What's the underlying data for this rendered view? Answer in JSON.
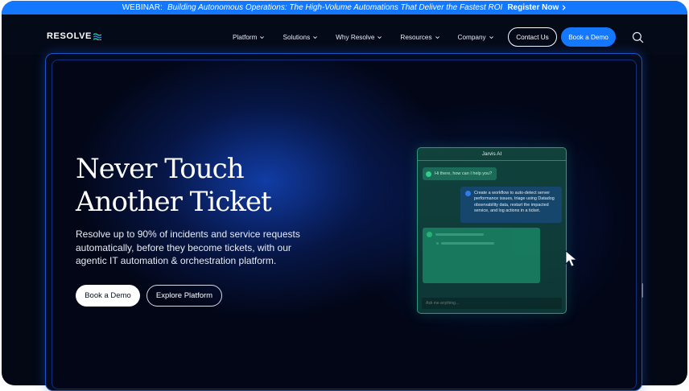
{
  "banner": {
    "lead": "WEBINAR:",
    "title": "Building Autonomous Operations: The High-Volume Automations That Deliver the Fastest ROI",
    "cta": "Register Now",
    "cta_icon": "chevron-right-icon"
  },
  "nav": {
    "logo_text": "RESOLVE",
    "menu": [
      {
        "label": "Platform"
      },
      {
        "label": "Solutions"
      },
      {
        "label": "Why Resolve"
      },
      {
        "label": "Resources"
      },
      {
        "label": "Company"
      }
    ],
    "contact_label": "Contact Us",
    "demo_label": "Book a Demo",
    "search_icon": "search-icon"
  },
  "hero": {
    "headline_line1": "Never Touch",
    "headline_line2": "Another Ticket",
    "subtext": "Resolve up to 90% of incidents and service requests automatically, before they become tickets, with our agentic IT automation & orchestration platform.",
    "primary_cta": "Book a Demo",
    "secondary_cta": "Explore Platform"
  },
  "chat": {
    "title": "Jarvis AI",
    "bot_greeting": "Hi there, how can I help you?",
    "user_message": "Create a workflow to auto-detect server performance issues, triage using Datadog observability data, restart the impacted service, and log actions in a ticket.",
    "input_placeholder": "Ask me anything..."
  },
  "colors": {
    "brand_blue": "#1478ff",
    "background": "#030814",
    "chat_border": "#2a9a78"
  }
}
